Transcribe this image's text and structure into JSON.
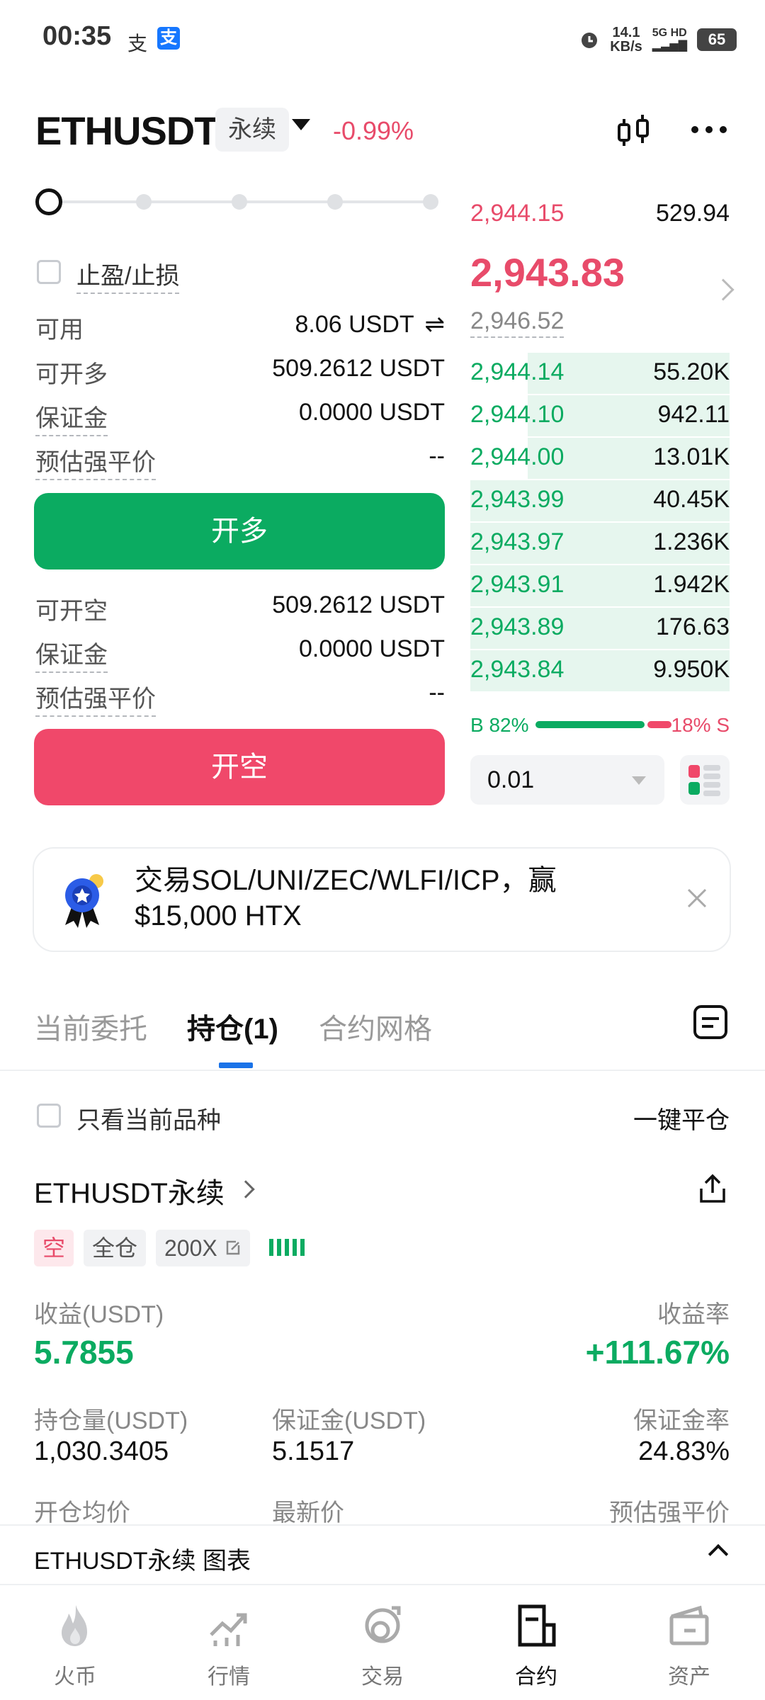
{
  "status_bar": {
    "time": "00:35",
    "icon_a": "支",
    "icon_b": "支",
    "net_speed_value": "14.1",
    "net_speed_unit": "KB/s",
    "signal_label": "5G HD",
    "battery": "65"
  },
  "header": {
    "pair": "ETHUSDT",
    "contract_type": "永续",
    "change": "-0.99%"
  },
  "order_form": {
    "tpsl_label": "止盈/止损",
    "available_label": "可用",
    "available_value": "8.06 USDT",
    "transfer_icon": "⇌",
    "long": {
      "max_open_label": "可开多",
      "max_open_value": "509.2612 USDT",
      "margin_label": "保证金",
      "margin_value": "0.0000 USDT",
      "liq_label": "预估强平价",
      "liq_value": "--",
      "button": "开多"
    },
    "short": {
      "max_open_label": "可开空",
      "max_open_value": "509.2612 USDT",
      "margin_label": "保证金",
      "margin_value": "0.0000 USDT",
      "liq_label": "预估强平价",
      "liq_value": "--",
      "button": "开空"
    }
  },
  "order_book": {
    "asks": [
      {
        "price": "2,944.15",
        "qty": "529.94"
      }
    ],
    "last_price": "2,943.83",
    "mark_price": "2,946.52",
    "bids": [
      {
        "price": "2,944.14",
        "qty": "55.20K",
        "depth": 0.78
      },
      {
        "price": "2,944.10",
        "qty": "942.11",
        "depth": 0.78
      },
      {
        "price": "2,944.00",
        "qty": "13.01K",
        "depth": 0.78
      },
      {
        "price": "2,943.99",
        "qty": "40.45K",
        "depth": 1.0
      },
      {
        "price": "2,943.97",
        "qty": "1.236K",
        "depth": 1.0
      },
      {
        "price": "2,943.91",
        "qty": "1.942K",
        "depth": 1.0
      },
      {
        "price": "2,943.89",
        "qty": "176.63",
        "depth": 1.0
      },
      {
        "price": "2,943.84",
        "qty": "9.950K",
        "depth": 1.0
      }
    ],
    "buy_ratio": "B 82%",
    "sell_ratio": "18% S",
    "buy_fraction": 0.82,
    "precision": "0.01"
  },
  "banner": {
    "text": "交易SOL/UNI/ZEC/WLFI/ICP，赢$15,000 HTX"
  },
  "tabs": [
    "当前委托",
    "持仓(1)",
    "合约网格"
  ],
  "positions": {
    "filter_label": "只看当前品种",
    "close_all": "一键平仓",
    "title": "ETHUSDT永续",
    "tags": [
      "空",
      "全仓",
      "200X"
    ],
    "pnl_label": "收益(USDT)",
    "pnl_value": "5.7855",
    "roe_label": "收益率",
    "roe_value": "+111.67%",
    "size_label": "持仓量(USDT)",
    "size_value": "1,030.3405",
    "margin_label": "保证金(USDT)",
    "margin_value": "5.1517",
    "margin_ratio_label": "保证金率",
    "margin_ratio_value": "24.83%",
    "entry_label": "开仓均价",
    "mark_label": "最新价",
    "liq_label": "预估强平价"
  },
  "chart_strip": {
    "label": "ETHUSDT永续 图表"
  },
  "nav": [
    "火币",
    "行情",
    "交易",
    "合约",
    "资产"
  ],
  "colors": {
    "green": "#0bab61",
    "red": "#e84b6a",
    "accent": "#1a73e8"
  }
}
